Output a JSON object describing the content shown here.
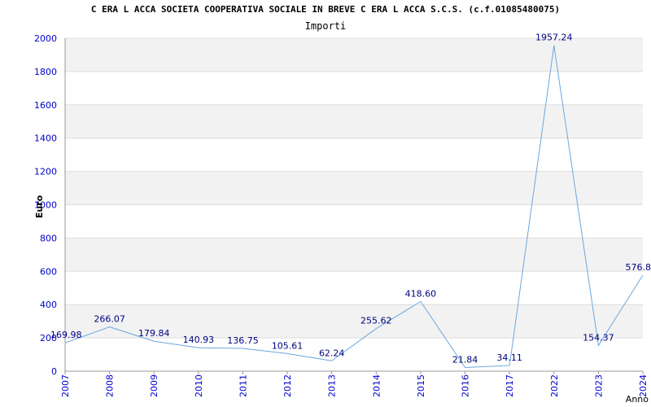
{
  "chart_data": {
    "type": "line",
    "title": "C ERA L ACCA SOCIETA COOPERATIVA SOCIALE IN BREVE C ERA L ACCA S.C.S. (c.f.01085480075)",
    "subtitle": "Importi",
    "xlabel": "Anno",
    "ylabel": "Euro",
    "categories": [
      "2007",
      "2008",
      "2009",
      "2010",
      "2011",
      "2012",
      "2013",
      "2014",
      "2015",
      "2016",
      "2017",
      "2022",
      "2023",
      "2024"
    ],
    "values": [
      169.98,
      266.07,
      179.84,
      140.93,
      136.75,
      105.61,
      62.24,
      255.62,
      418.6,
      21.84,
      34.11,
      1957.24,
      154.37,
      576.8
    ],
    "data_labels": [
      "169.98",
      "266.07",
      "179.84",
      "140.93",
      "136.75",
      "105.61",
      "62.24",
      "255.62",
      "418.60",
      "21.84",
      "34.11",
      "1957.24",
      "154.37",
      "576.8"
    ],
    "ylim": [
      0,
      2000
    ],
    "yticks": [
      "0",
      "200",
      "400",
      "600",
      "800",
      "1000",
      "1200",
      "1400",
      "1600",
      "1800",
      "2000"
    ],
    "grid": true,
    "band_colors": [
      "#f2f2f2",
      "#ffffff"
    ],
    "line_color": "#6aa8e0",
    "tick_color": "#0000cc",
    "label_color": "#000080"
  }
}
